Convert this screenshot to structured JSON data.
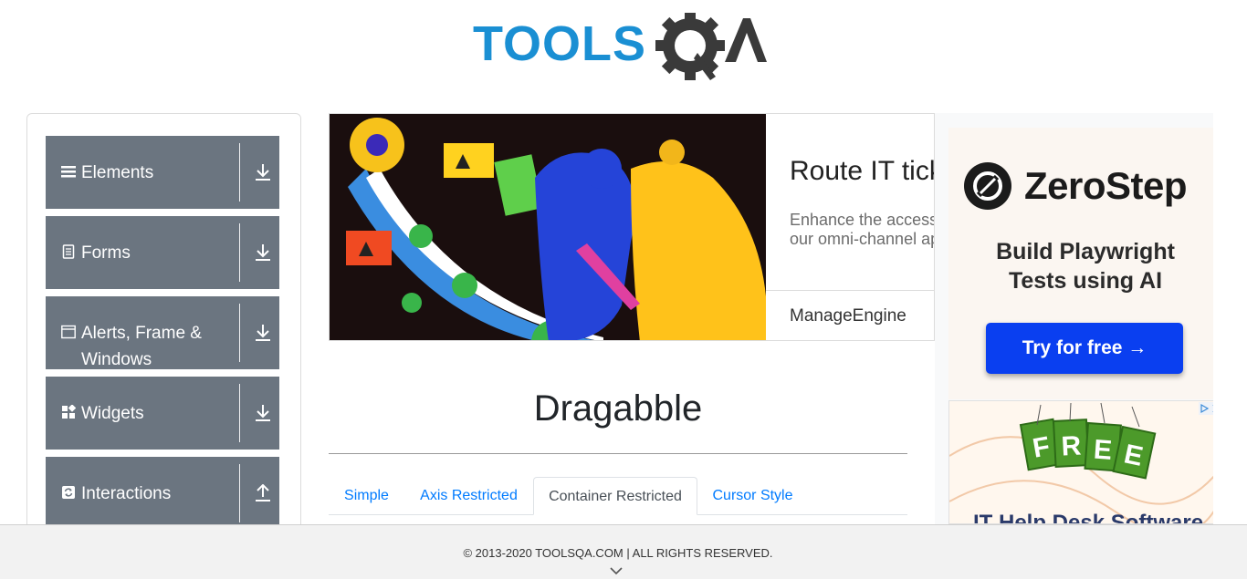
{
  "header": {
    "logo_text_part1": "TOOLS",
    "logo_text_part2": "QA"
  },
  "sidebar": {
    "groups": [
      {
        "label": "Elements",
        "icon": "list-icon",
        "arrow": "download"
      },
      {
        "label": "Forms",
        "icon": "document-icon",
        "arrow": "download"
      },
      {
        "label": "Alerts, Frame & Windows",
        "icon": "window-icon",
        "arrow": "download"
      },
      {
        "label": "Widgets",
        "icon": "widgets-icon",
        "arrow": "download"
      },
      {
        "label": "Interactions",
        "icon": "sync-icon",
        "arrow": "upload"
      }
    ]
  },
  "ad_banner": {
    "headline": "Route IT tick",
    "body_line1": "Enhance the access",
    "body_line2": "our omni-channel ap",
    "brand": "ManageEngine"
  },
  "right_ad": {
    "brand": "ZeroStep",
    "tagline_line1": "Build Playwright",
    "tagline_line2": "Tests using AI",
    "cta": "Try for free →",
    "free_badge": "FREE",
    "free_caption": "IT Help Desk Software"
  },
  "main": {
    "title": "Dragabble",
    "tabs": [
      {
        "label": "Simple",
        "active": false
      },
      {
        "label": "Axis Restricted",
        "active": false
      },
      {
        "label": "Container Restricted",
        "active": true
      },
      {
        "label": "Cursor Style",
        "active": false
      }
    ]
  },
  "footer": {
    "copyright": "© 2013-2020 TOOLSQA.COM | ALL RIGHTS RESERVED."
  },
  "colors": {
    "brand_blue": "#1a8fd3",
    "sidebar_group_bg": "#6b7580",
    "tab_link": "#007bff",
    "cta_blue": "#0a3ff0"
  }
}
